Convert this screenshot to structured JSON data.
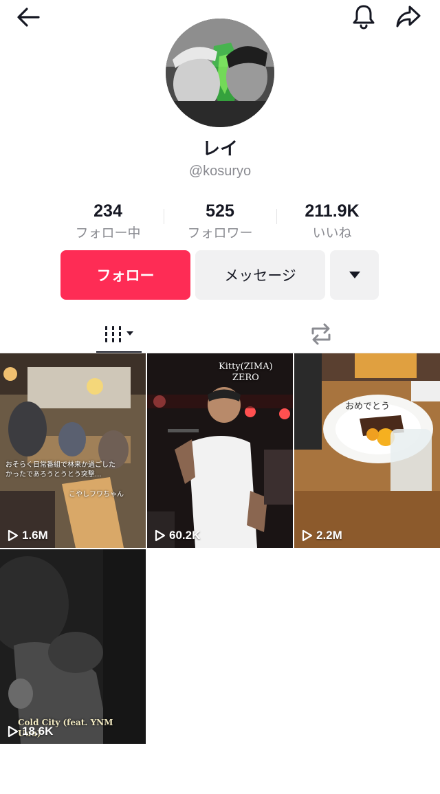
{
  "header": {
    "back_icon": "arrow-left-icon",
    "bell_icon": "bell-icon",
    "share_icon": "share-icon"
  },
  "profile": {
    "nickname": "レイ",
    "username": "@kosuryo"
  },
  "stats": [
    {
      "value": "234",
      "label": "フォロー中"
    },
    {
      "value": "525",
      "label": "フォロワー"
    },
    {
      "value": "211.9K",
      "label": "いいね"
    }
  ],
  "actions": {
    "follow": "フォロー",
    "message": "メッセージ"
  },
  "colors": {
    "accent": "#fe2c55",
    "secondary_button": "#f1f1f2",
    "muted_text": "#8a8b91"
  },
  "videos": [
    {
      "views": "1.6M",
      "caption": "おそらく日常番組で林来か過ごした\nかったであろうとうとう突撃...",
      "caption2": "こやしフワちゃん"
    },
    {
      "views": "60.2K",
      "caption": "Kitty(ZIMA)\nZERO"
    },
    {
      "views": "2.2M",
      "caption": "おめでとう"
    },
    {
      "views": "18.6K",
      "caption": "Cold City (feat. YNM\nUuu)"
    }
  ]
}
